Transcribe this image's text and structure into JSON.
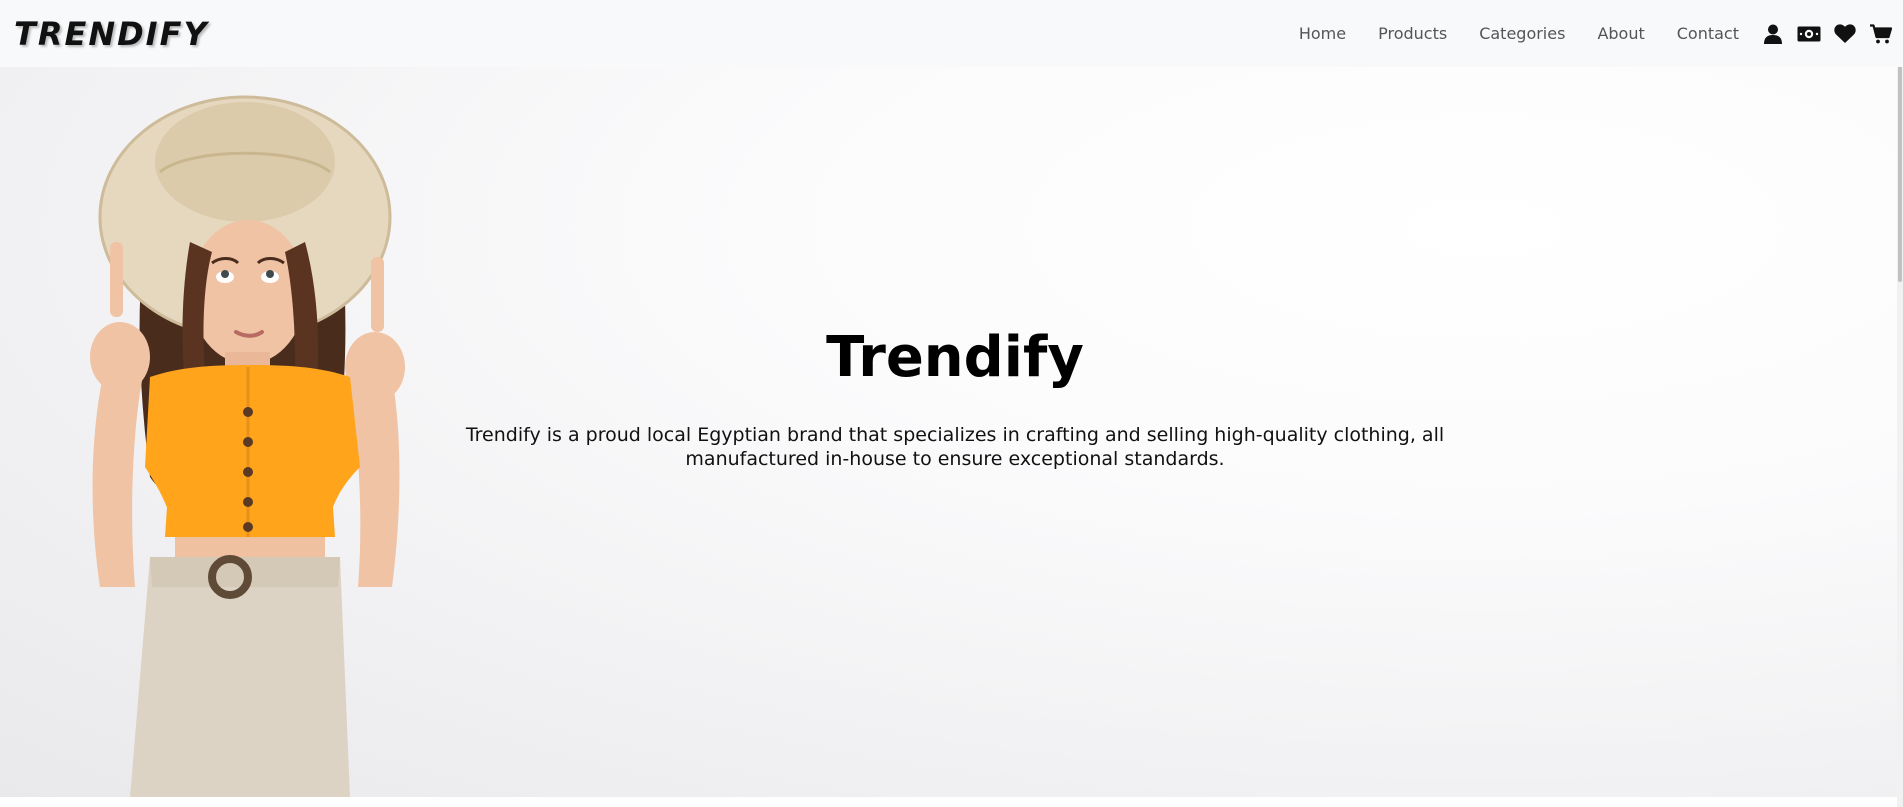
{
  "navbar": {
    "brand": "TRENDIFY",
    "links": [
      {
        "label": "Home"
      },
      {
        "label": "Products"
      },
      {
        "label": "Categories"
      },
      {
        "label": "About"
      },
      {
        "label": "Contact"
      }
    ],
    "icons": [
      "user-icon",
      "money-icon",
      "heart-icon",
      "cart-icon"
    ]
  },
  "hero": {
    "title": "Trendify",
    "description": "Trendify is a proud local Egyptian brand that specializes in crafting and selling high-quality clothing, all manufactured in-house to ensure exceptional standards.",
    "image_subject": "woman in straw hat and orange top pointing up"
  },
  "colors": {
    "navbar_bg": "#f8f9fa",
    "text_dark": "#000000",
    "nav_link": "#555555",
    "accent_top": "#ffa41b"
  }
}
